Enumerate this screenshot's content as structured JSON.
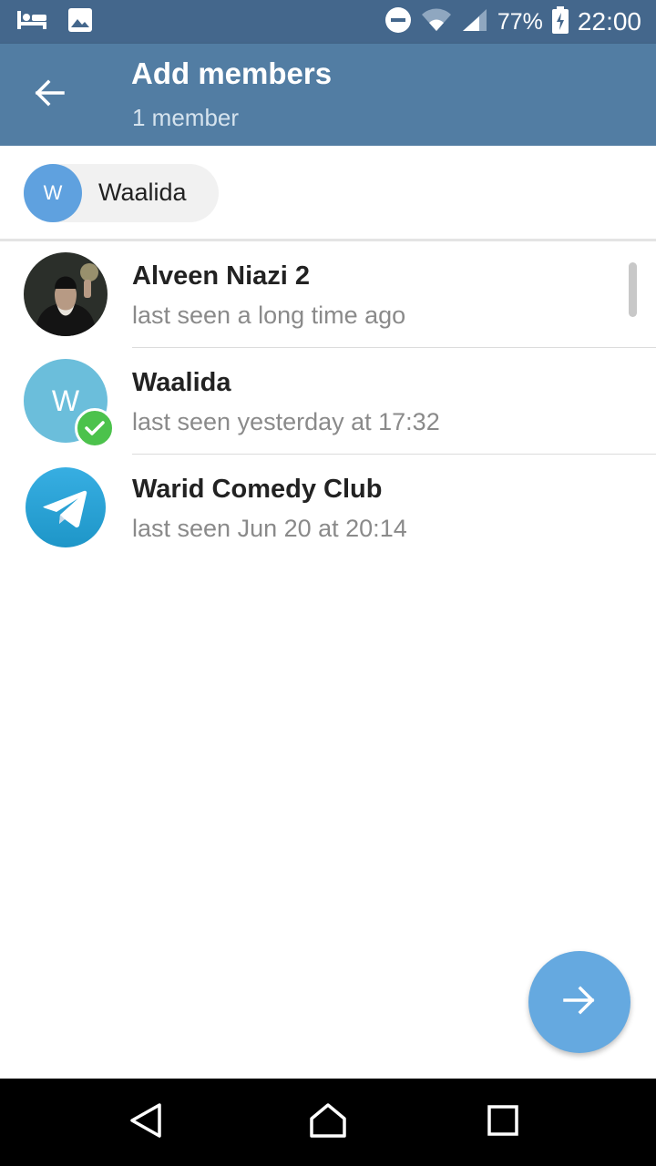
{
  "status_bar": {
    "battery": "77%",
    "time": "22:00",
    "icons": [
      "bed-icon",
      "image-icon",
      "do-not-disturb-icon",
      "wifi-icon",
      "signal-icon",
      "battery-charging-icon"
    ]
  },
  "toolbar": {
    "title": "Add members",
    "subtitle": "1 member",
    "back_icon": "arrow-left-icon"
  },
  "selected_chips": [
    {
      "initial": "W",
      "label": "Waalida"
    }
  ],
  "contacts": [
    {
      "name": "Alveen Niazi 2",
      "status": "last seen a long time ago",
      "avatar": "photo"
    },
    {
      "name": "Waalida",
      "status": "last seen yesterday at 17:32",
      "avatar_letter": "W",
      "selected": true
    },
    {
      "name": "Warid Comedy Club",
      "status": "last seen Jun 20 at 20:14",
      "avatar": "telegram-logo"
    }
  ],
  "fab": {
    "icon": "arrow-right-icon"
  },
  "colors": {
    "status_bar": "#44678c",
    "toolbar": "#527da3",
    "fab": "#65a9e0",
    "check": "#4cc24c"
  }
}
